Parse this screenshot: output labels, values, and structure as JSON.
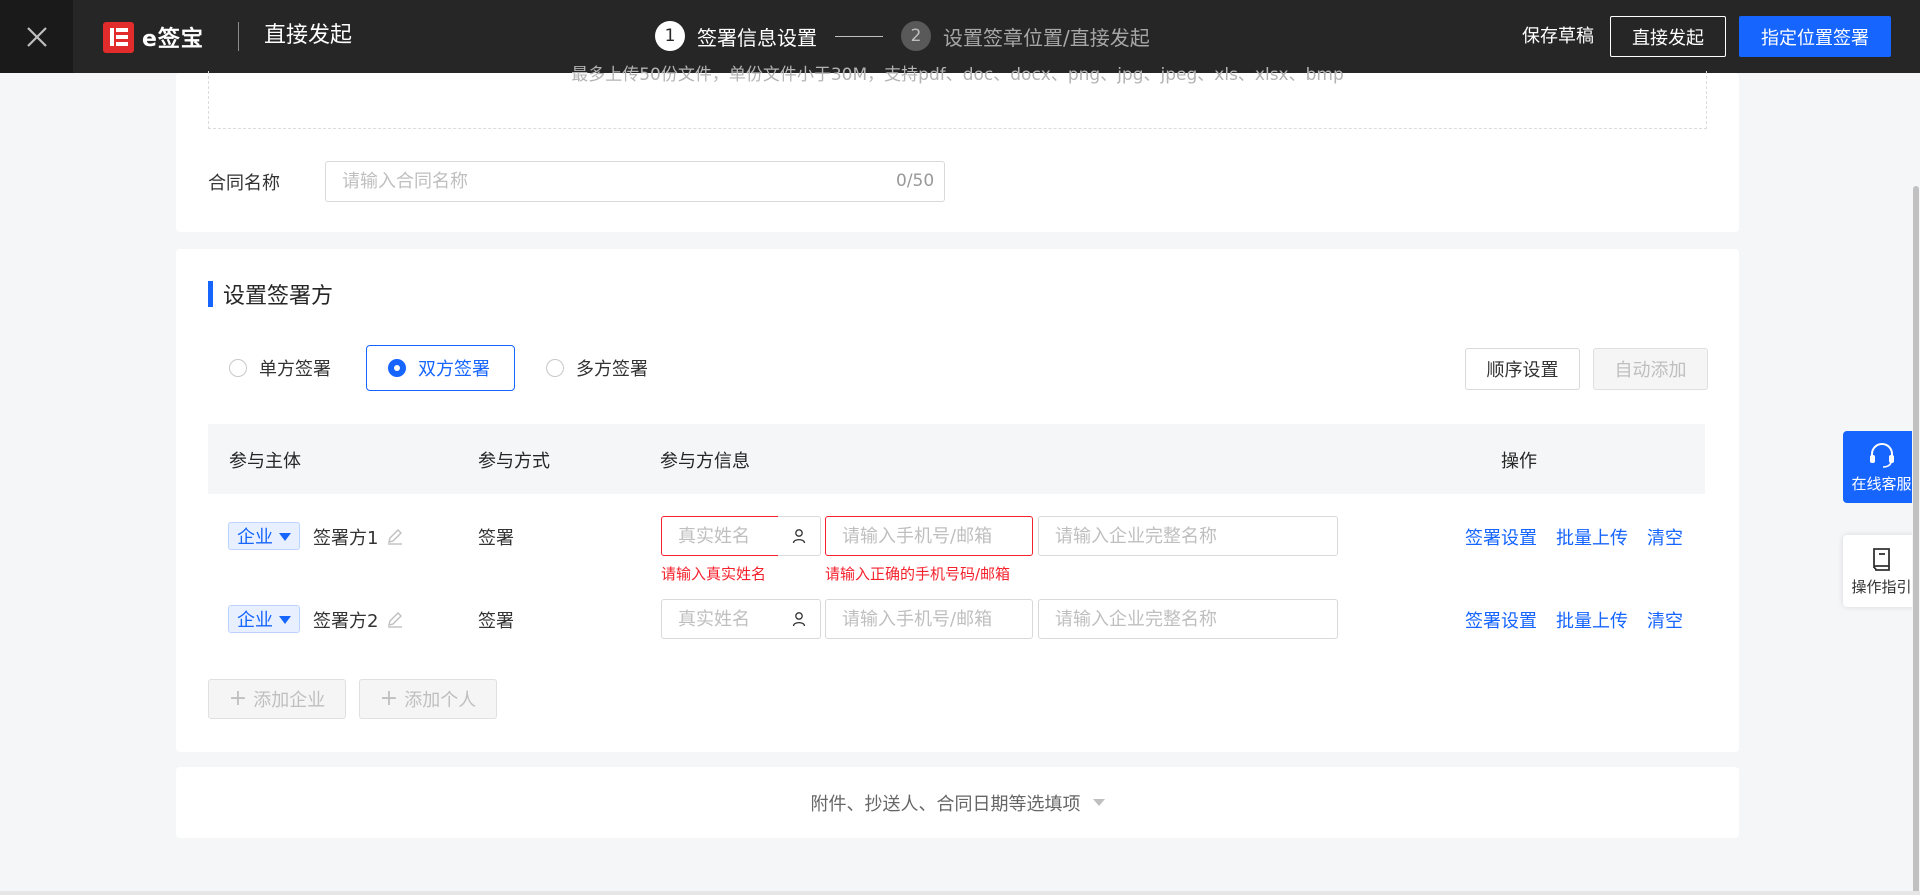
{
  "topbar": {
    "logo_text": "e签宝",
    "logo_mark": "E",
    "title": "直接发起",
    "steps": [
      {
        "num": "1",
        "label": "签署信息设置"
      },
      {
        "num": "2",
        "label": "设置签章位置/直接发起"
      }
    ],
    "save_draft": "保存草稿",
    "direct_start": "直接发起",
    "position_sign": "指定位置签署"
  },
  "contract": {
    "upload_hint": "最多上传50份文件，单份文件小于30M，支持pdf、doc、docx、png、jpg、jpeg、xls、xlsx、bmp",
    "name_label": "合同名称",
    "name_placeholder": "请输入合同名称",
    "name_counter": "0/50"
  },
  "signers": {
    "title": "设置签署方",
    "modes": [
      "单方签署",
      "双方签署",
      "多方签署"
    ],
    "order_button": "顺序设置",
    "auto_add_button": "自动添加",
    "columns": [
      "参与主体",
      "参与方式",
      "参与方信息",
      "操作"
    ],
    "rows": [
      {
        "type": "企业",
        "name": "签署方1",
        "method": "签署",
        "real_name_placeholder": "真实姓名",
        "contact_placeholder": "请输入手机号/邮箱",
        "company_placeholder": "请输入企业完整名称",
        "name_error": "请输入真实姓名",
        "contact_error": "请输入正确的手机号码/邮箱",
        "actions": [
          "签署设置",
          "批量上传",
          "清空"
        ]
      },
      {
        "type": "企业",
        "name": "签署方2",
        "method": "签署",
        "real_name_placeholder": "真实姓名",
        "contact_placeholder": "请输入手机号/邮箱",
        "company_placeholder": "请输入企业完整名称",
        "actions": [
          "签署设置",
          "批量上传",
          "清空"
        ]
      }
    ],
    "add_company": "添加企业",
    "add_person": "添加个人"
  },
  "optional": {
    "label": "附件、抄送人、合同日期等选填项"
  },
  "float": {
    "service": "在线客服",
    "guide": "操作指引"
  },
  "colors": {
    "primary": "#1665ff",
    "error": "#f5222d",
    "topbar": "#262626"
  }
}
